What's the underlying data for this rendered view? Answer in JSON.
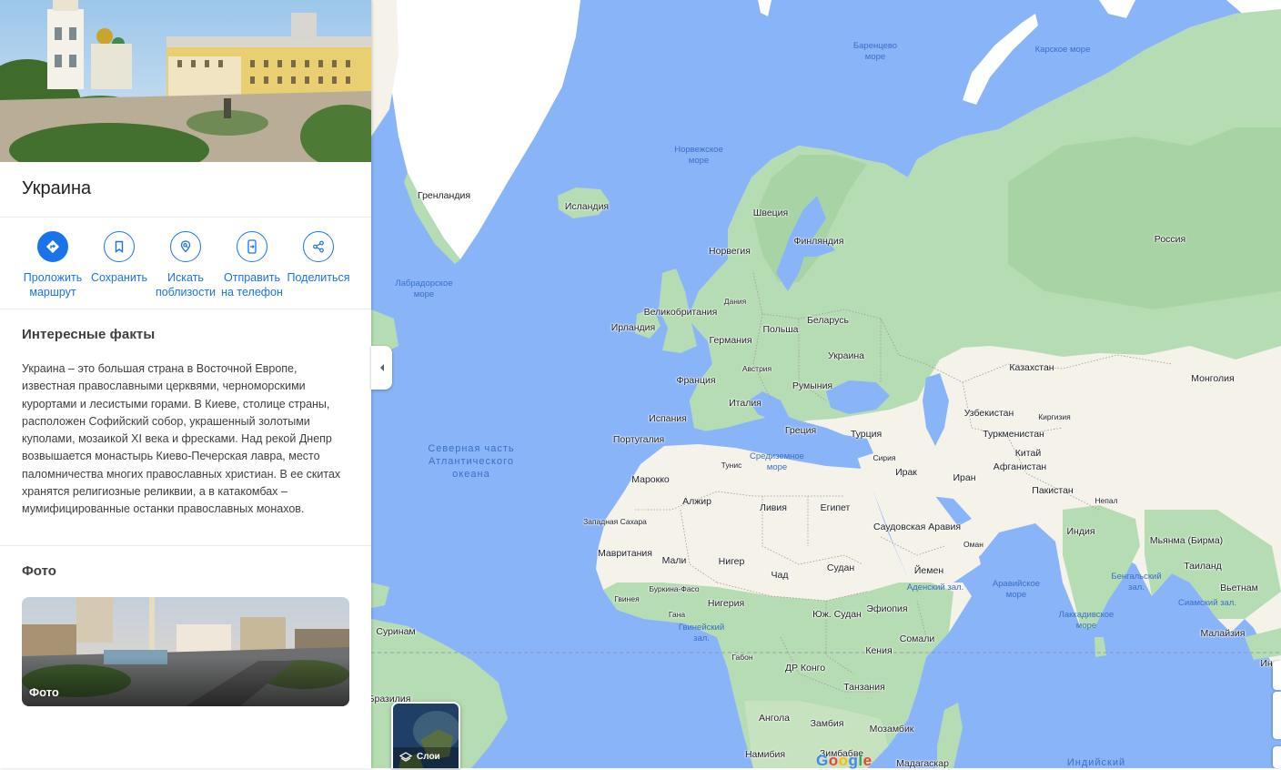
{
  "place": {
    "title": "Украина"
  },
  "actions": [
    {
      "label": "Проложить\nмаршрут",
      "icon": "directions-icon"
    },
    {
      "label": "Сохранить",
      "icon": "bookmark-icon"
    },
    {
      "label": "Искать\nпоблизости",
      "icon": "nearby-icon"
    },
    {
      "label": "Отправить\nна телефон",
      "icon": "send-to-phone-icon"
    },
    {
      "label": "Поделиться",
      "icon": "share-icon"
    }
  ],
  "facts": {
    "title": "Интересные факты",
    "text": "Украина – это большая страна в Восточной Европе, известная православными церквями, черноморскими курортами и лесистыми горами. В Киеве, столице страны, расположен Софийский собор, украшенный золотыми куполами, мозаикой XI века и фресками. Над рекой Днепр возвышается монастырь Киево-Печерская лавра, место паломничества многих православных христиан. В ее скитах хранятся религиозные реликвии, а в катакомбах – мумифицированные останки православных монахов."
  },
  "photos": {
    "title": "Фото",
    "card_label": "Фото"
  },
  "map": {
    "layers_label": "Слои",
    "logo": "Google",
    "colors": {
      "water": "#8ab4f8",
      "land": "#f5f2ea",
      "vegetation": "#b6dcb3",
      "ice": "#ffffff"
    },
    "country_labels": [
      "Гренландия",
      "Исландия",
      "Швеция",
      "Финляндия",
      "Норвегия",
      "Россия",
      "Дания",
      "Великобритания",
      "Ирландия",
      "Польша",
      "Беларусь",
      "Германия",
      "Австрия",
      "Украина",
      "Франция",
      "Румыния",
      "Казахстан",
      "Монголия",
      "Италия",
      "Испания",
      "Португалия",
      "Греция",
      "Турция",
      "Узбекистан",
      "Киргизия",
      "Туркменистан",
      "Китай",
      "Тунис",
      "Сирия",
      "Ирак",
      "Иран",
      "Афганистан",
      "Марокко",
      "Алжир",
      "Ливия",
      "Египет",
      "Пакистан",
      "Непал",
      "Западная Сахара",
      "Саудовская Аравия",
      "Индия",
      "Мьянма (Бирма)",
      "Мавритания",
      "Мали",
      "Нигер",
      "Чад",
      "Судан",
      "Оман",
      "Йемен",
      "Таиланд",
      "Вьетнам",
      "Буркина-Фасо",
      "Гвинея",
      "Нигерия",
      "Эфиопия",
      "Гана",
      "Юж. Судан",
      "Суринам",
      "Сомали",
      "Малайзия",
      "Габон",
      "Кения",
      "Индо",
      "ДР Конго",
      "Бразилия",
      "Танзания",
      "Ангола",
      "Замбия",
      "Мозамбик",
      "Намибия",
      "Зимбабве",
      "Мадагаскар"
    ],
    "water_labels": [
      "Баренцево\nморе",
      "Карское море",
      "Норвежское\nморе",
      "Лабрадорское\nморе",
      "Северная часть\nАтлантического\nокеана",
      "Средиземное\nморе",
      "Аденский зал.",
      "Аравийское\nморе",
      "Бенгальский\nзал.",
      "Сиамский зал.",
      "Лаккадивское\nморе",
      "Гвинейский\nзал.",
      "Индийский"
    ]
  }
}
